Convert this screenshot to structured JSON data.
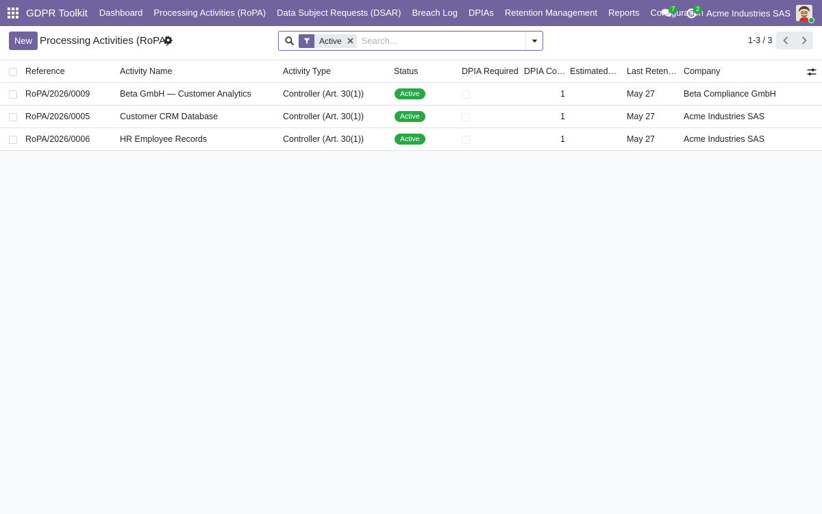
{
  "navbar": {
    "brand": "GDPR Toolkit",
    "menu": [
      "Dashboard",
      "Processing Activities (RoPA)",
      "Data Subject Requests (DSAR)",
      "Breach Log",
      "DPIAs",
      "Retention Management",
      "Reports",
      "Configuration"
    ],
    "messages_count": "7",
    "activities_count": "2",
    "company": "Acme Industries SAS"
  },
  "control_panel": {
    "new_label": "New",
    "title": "Processing Activities (RoPA)",
    "filter_facet": "Active",
    "search_placeholder": "Search...",
    "pager_value": "1-3 / 3"
  },
  "list": {
    "columns": [
      "Reference",
      "Activity Name",
      "Activity Type",
      "Status",
      "DPIA Required",
      "DPIA Count",
      "Estimated Volume",
      "Last Retention Review",
      "Company"
    ],
    "rows": [
      {
        "reference": "RoPA/2026/0009",
        "name": "Beta GmbH — Customer Analytics",
        "type": "Controller (Art. 30(1))",
        "status": "Active",
        "dpia_count": "1",
        "last_retention": "May 27",
        "company": "Beta Compliance GmbH"
      },
      {
        "reference": "RoPA/2026/0005",
        "name": "Customer CRM Database",
        "type": "Controller (Art. 30(1))",
        "status": "Active",
        "dpia_count": "1",
        "last_retention": "May 27",
        "company": "Acme Industries SAS"
      },
      {
        "reference": "RoPA/2026/0006",
        "name": "HR Employee Records",
        "type": "Controller (Art. 30(1))",
        "status": "Active",
        "dpia_count": "1",
        "last_retention": "May 27",
        "company": "Acme Industries SAS"
      }
    ]
  },
  "colors": {
    "brand": "#71639e",
    "status_active": "#28a745"
  },
  "icons": [
    "apps-grid-icon",
    "chat-icon",
    "clock-icon",
    "gear-icon",
    "search-icon",
    "filter-icon",
    "close-icon",
    "caret-down-icon",
    "chevron-left-icon",
    "chevron-right-icon",
    "sliders-icon"
  ]
}
